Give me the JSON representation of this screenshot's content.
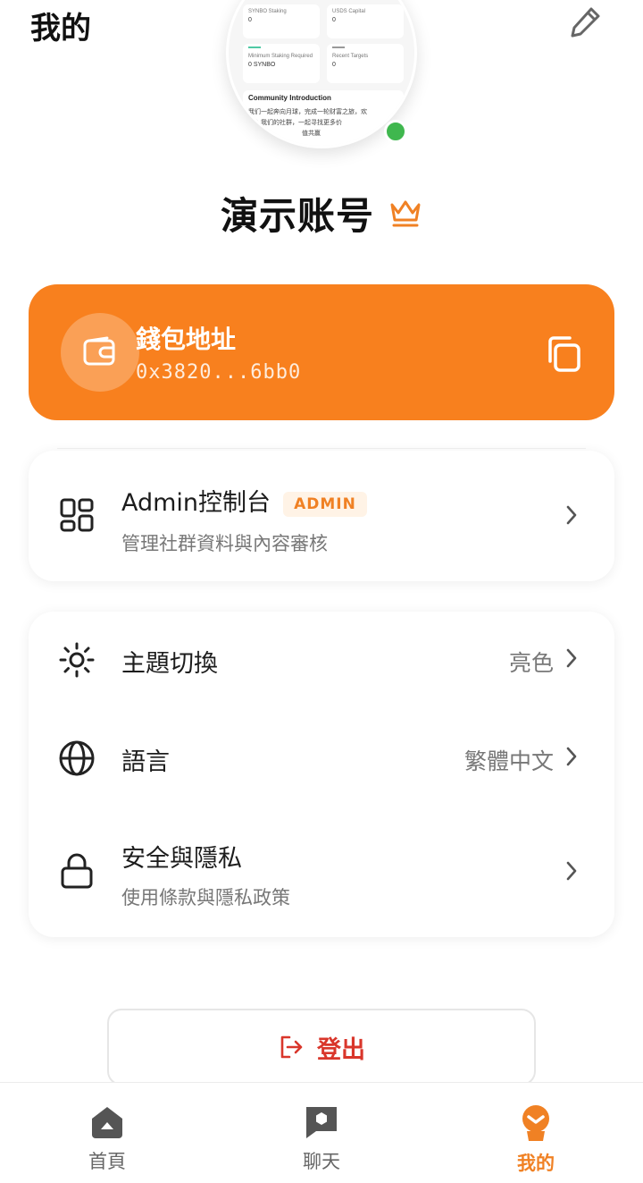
{
  "header": {
    "title": "我的",
    "edit_icon": "pencil-icon"
  },
  "avatar_preview": {
    "cards": [
      {
        "label": "SYNBO Staking",
        "value": "0"
      },
      {
        "label": "USDS Capital",
        "value": "0"
      },
      {
        "label": "Minimum Staking Required",
        "value": "0 SYNBO"
      },
      {
        "label": "Recent Targets",
        "value": "0"
      }
    ],
    "intro_title": "Community Introduction",
    "intro_line1": "我们一起奔向月球，完成一轮财富之旅，欢",
    "intro_line2": "迎入我们的社群，一起寻找更多价",
    "intro_line3": "值共赢"
  },
  "profile": {
    "username": "演示账号",
    "badge_icon": "crown-icon",
    "online_color": "#3fb74e"
  },
  "wallet": {
    "title": "錢包地址",
    "address": "0x3820...6bb0",
    "icon": "wallet-icon",
    "copy_icon": "copy-icon",
    "color": "#f8801e"
  },
  "admin": {
    "title": "Admin控制台",
    "badge": "ADMIN",
    "subtitle": "管理社群資料與內容審核",
    "icon": "dashboard-grid-icon"
  },
  "settings": [
    {
      "title": "主題切換",
      "value": "亮色",
      "icon": "sun-icon"
    },
    {
      "title": "語言",
      "value": "繁體中文",
      "icon": "globe-icon"
    },
    {
      "title": "安全與隱私",
      "subtitle": "使用條款與隱私政策",
      "icon": "lock-icon"
    }
  ],
  "logout": {
    "label": "登出",
    "icon": "logout-icon"
  },
  "nav": [
    {
      "label": "首頁",
      "icon": "home-icon",
      "active": false
    },
    {
      "label": "聊天",
      "icon": "chat-icon",
      "active": false
    },
    {
      "label": "我的",
      "icon": "profile-icon",
      "active": true
    }
  ],
  "accent_color": "#f08124"
}
